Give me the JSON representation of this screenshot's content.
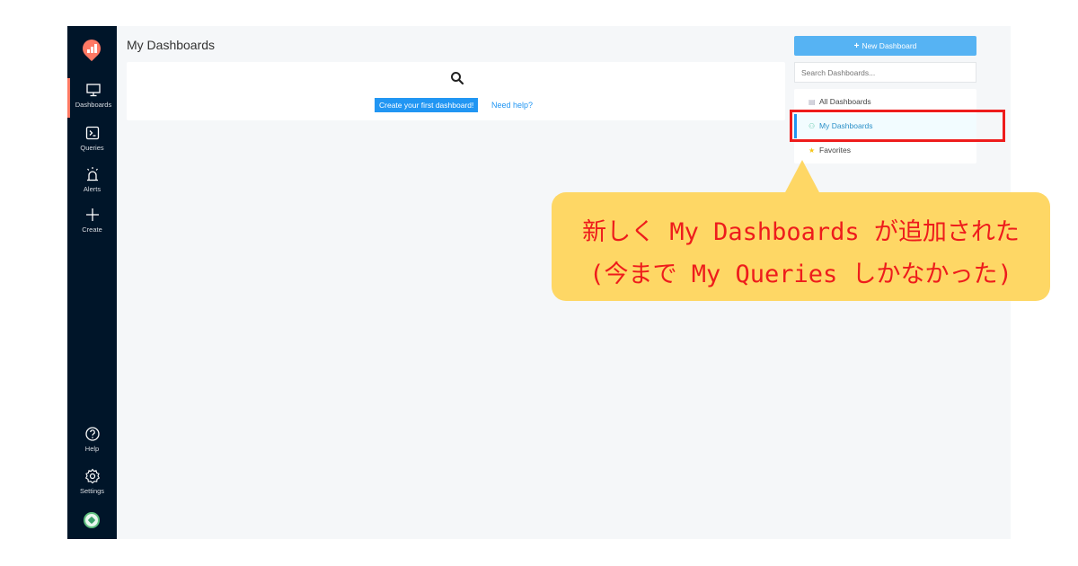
{
  "sidebar": {
    "logo_icon": "redash-logo-icon",
    "items": [
      {
        "label": "Dashboards",
        "icon": "monitor-icon"
      },
      {
        "label": "Queries",
        "icon": "terminal-icon"
      },
      {
        "label": "Alerts",
        "icon": "alarm-icon"
      },
      {
        "label": "Create",
        "icon": "plus-icon"
      }
    ],
    "bottom_items": [
      {
        "label": "Help",
        "icon": "question-circle-icon"
      },
      {
        "label": "Settings",
        "icon": "gear-icon"
      }
    ],
    "active_color": "#ff7964"
  },
  "main": {
    "title": "My Dashboards",
    "empty_state": {
      "icon": "search-icon",
      "create_label": "Create your first dashboard!",
      "help_label": "Need help?"
    }
  },
  "right_panel": {
    "new_button_label": "New Dashboard",
    "search_placeholder": "Search Dashboards...",
    "filters": [
      {
        "label": "All Dashboards",
        "icon": "list-icon"
      },
      {
        "label": "My Dashboards",
        "icon": "user-icon"
      },
      {
        "label": "Favorites",
        "icon": "star-icon"
      }
    ]
  },
  "annotation": {
    "line1": "新しく My Dashboards が追加された",
    "line2": "(今まで My Queries しかなかった)",
    "highlight_color": "#ee1c1c",
    "bubble_color": "#fed765"
  },
  "colors": {
    "sidebar_bg": "#001529",
    "primary": "#2196f3"
  }
}
